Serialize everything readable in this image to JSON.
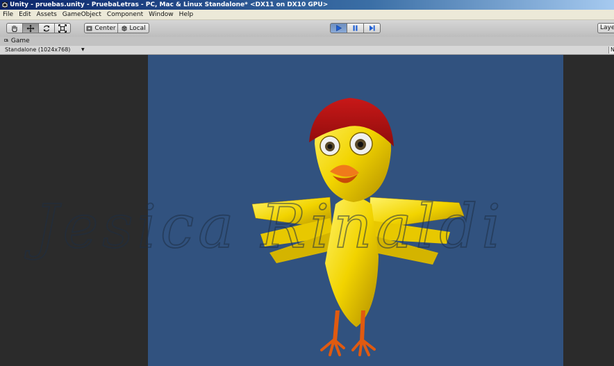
{
  "window": {
    "title": "Unity - pruebas.unity - PruebaLetras - PC, Mac & Linux Standalone* <DX11 on DX10 GPU>"
  },
  "menu": {
    "items": [
      "File",
      "Edit",
      "Assets",
      "GameObject",
      "Component",
      "Window",
      "Help"
    ]
  },
  "toolbar": {
    "tools": [
      {
        "name": "hand-tool",
        "icon": "hand-icon"
      },
      {
        "name": "move-tool",
        "icon": "move-arrows-icon",
        "active": true
      },
      {
        "name": "rotate-tool",
        "icon": "rotate-icon"
      },
      {
        "name": "scale-tool",
        "icon": "scale-icon"
      }
    ],
    "pivot_label": "Center",
    "space_label": "Local",
    "playback": [
      {
        "name": "play-button",
        "icon": "play-icon",
        "active": true
      },
      {
        "name": "pause-button",
        "icon": "pause-icon"
      },
      {
        "name": "step-button",
        "icon": "step-icon"
      }
    ],
    "layers_label": "Laye"
  },
  "game_tab": {
    "label": "Game",
    "resolution": "Standalone (1024x768)",
    "right_stub": "N"
  },
  "scene": {
    "background_color": "#31527f",
    "character": "yellow-chick-with-red-cap",
    "watermark": "Jesica Rinaldi"
  }
}
